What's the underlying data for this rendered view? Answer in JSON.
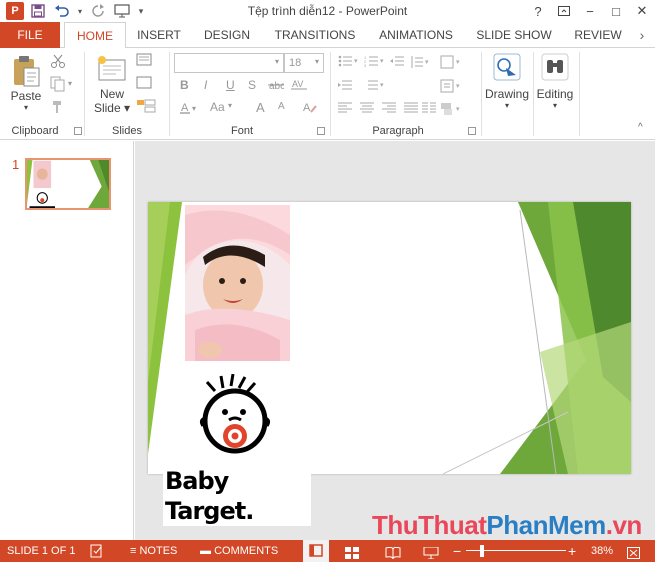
{
  "window": {
    "title": "Tệp trình diễn12 - PowerPoint",
    "help": "?",
    "controls": [
      "−",
      "□",
      "✕"
    ]
  },
  "tabs": [
    {
      "label": "FILE"
    },
    {
      "label": "HOME"
    },
    {
      "label": "INSERT"
    },
    {
      "label": "DESIGN"
    },
    {
      "label": "TRANSITIONS"
    },
    {
      "label": "ANIMATIONS"
    },
    {
      "label": "SLIDE SHOW"
    },
    {
      "label": "REVIEW"
    }
  ],
  "ribbon": {
    "clipboard": {
      "paste": "Paste",
      "label": "Clipboard"
    },
    "slides": {
      "new_slide_line1": "New",
      "new_slide_line2": "Slide",
      "label": "Slides"
    },
    "font": {
      "font_size": "18",
      "label": "Font",
      "bold": "B",
      "italic": "I",
      "underline": "U",
      "strike": "S",
      "case": "Aa",
      "grow": "A",
      "shrink": "A"
    },
    "paragraph": {
      "label": "Paragraph"
    },
    "drawing": {
      "label": "Drawing"
    },
    "editing": {
      "label": "Editing"
    }
  },
  "thumbnails": [
    {
      "number": "1"
    }
  ],
  "slide": {
    "logo_text": "Baby Target."
  },
  "statusbar": {
    "slide_info": "SLIDE 1 OF 1",
    "notes": "NOTES",
    "comments": "COMMENTS",
    "zoom": "38%"
  },
  "watermark": {
    "part1": "ThuThuat",
    "part2": "PhanMem",
    "part3": ".vn"
  },
  "colors": {
    "accent": "#d24726",
    "slide_green": "#7ab648"
  }
}
